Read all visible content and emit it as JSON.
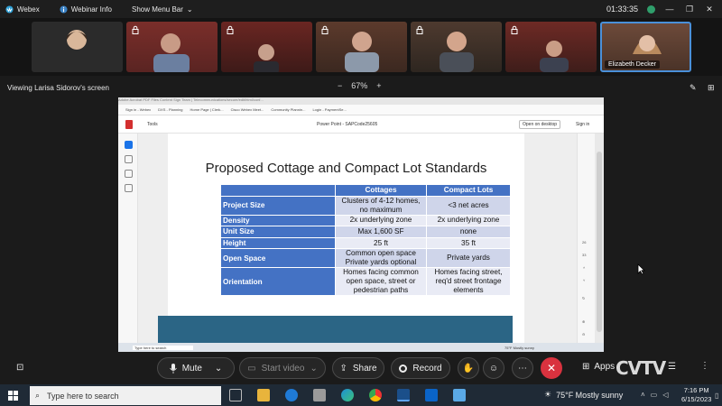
{
  "titlebar": {
    "app_name": "Webex",
    "webinar_info": "Webinar Info",
    "show_menu_bar": "Show Menu Bar",
    "timer": "01:33:35"
  },
  "participants": {
    "tiles": [
      {
        "name": ""
      },
      {
        "name": ""
      },
      {
        "name": ""
      },
      {
        "name": ""
      },
      {
        "name": ""
      },
      {
        "name": ""
      },
      {
        "name": "Elizabeth Decker"
      }
    ]
  },
  "viewbar": {
    "viewing_label": "Viewing Larisa Sidorov's screen",
    "zoom_minus": "−",
    "zoom_level": "67%",
    "zoom_plus": "+"
  },
  "shared_screen": {
    "url_text": "Adobe Acrobat PDF Files  Content Sign Team | Telecommunications/secure/edit/html/conf...",
    "bookmarks": [
      "Sign in - Webex",
      "DXS - Planning",
      "Home Page | Clerk...",
      "Cisco Webex Meet...",
      "Community Plannin...",
      "Login - PaymentSe..."
    ],
    "pdf_toolbar": {
      "tools": "Tools",
      "file_name": "Power Point - SAPCode25605",
      "open_in_app": "Open on desktop",
      "sign_in": "Sign in"
    },
    "page_numbers": [
      "26",
      "33"
    ],
    "slide": {
      "title": "Proposed Cottage and Compact Lot Standards",
      "columns": [
        "",
        "Cottages",
        "Compact Lots"
      ],
      "rows": [
        {
          "label": "Project Size",
          "cottages": "Clusters of 4-12 homes, no maximum",
          "compact": "<3 net acres"
        },
        {
          "label": "Density",
          "cottages": "2x underlying zone",
          "compact": "2x underlying zone"
        },
        {
          "label": "Unit Size",
          "cottages": "Max 1,600 SF",
          "compact": "none"
        },
        {
          "label": "Height",
          "cottages": "25 ft",
          "compact": "35 ft"
        },
        {
          "label": "Open Space",
          "cottages": "Common open space Private yards optional",
          "compact": "Private yards"
        },
        {
          "label": "Orientation",
          "cottages": "Homes facing common open space, street or pedestrian paths",
          "compact": "Homes facing street, req'd street frontage elements"
        }
      ]
    },
    "inner_taskbar": {
      "search": "Type here to search",
      "weather": "75°F  Mostly sunny"
    }
  },
  "controls": {
    "mute": "Mute",
    "start_video": "Start video",
    "share": "Share",
    "record": "Record",
    "apps": "Apps",
    "watermark": "CVTV"
  },
  "taskbar": {
    "search_placeholder": "Type here to search",
    "weather": "75°F  Mostly sunny",
    "time": "7:16 PM",
    "date": "6/15/2023"
  },
  "colors": {
    "table_header": "#4472c4",
    "row_light": "#e9ebf5",
    "row_dark": "#cfd5ea",
    "slide_band": "#2b6585",
    "end_button": "#d9323f",
    "selected_tile": "#4a90d9"
  }
}
